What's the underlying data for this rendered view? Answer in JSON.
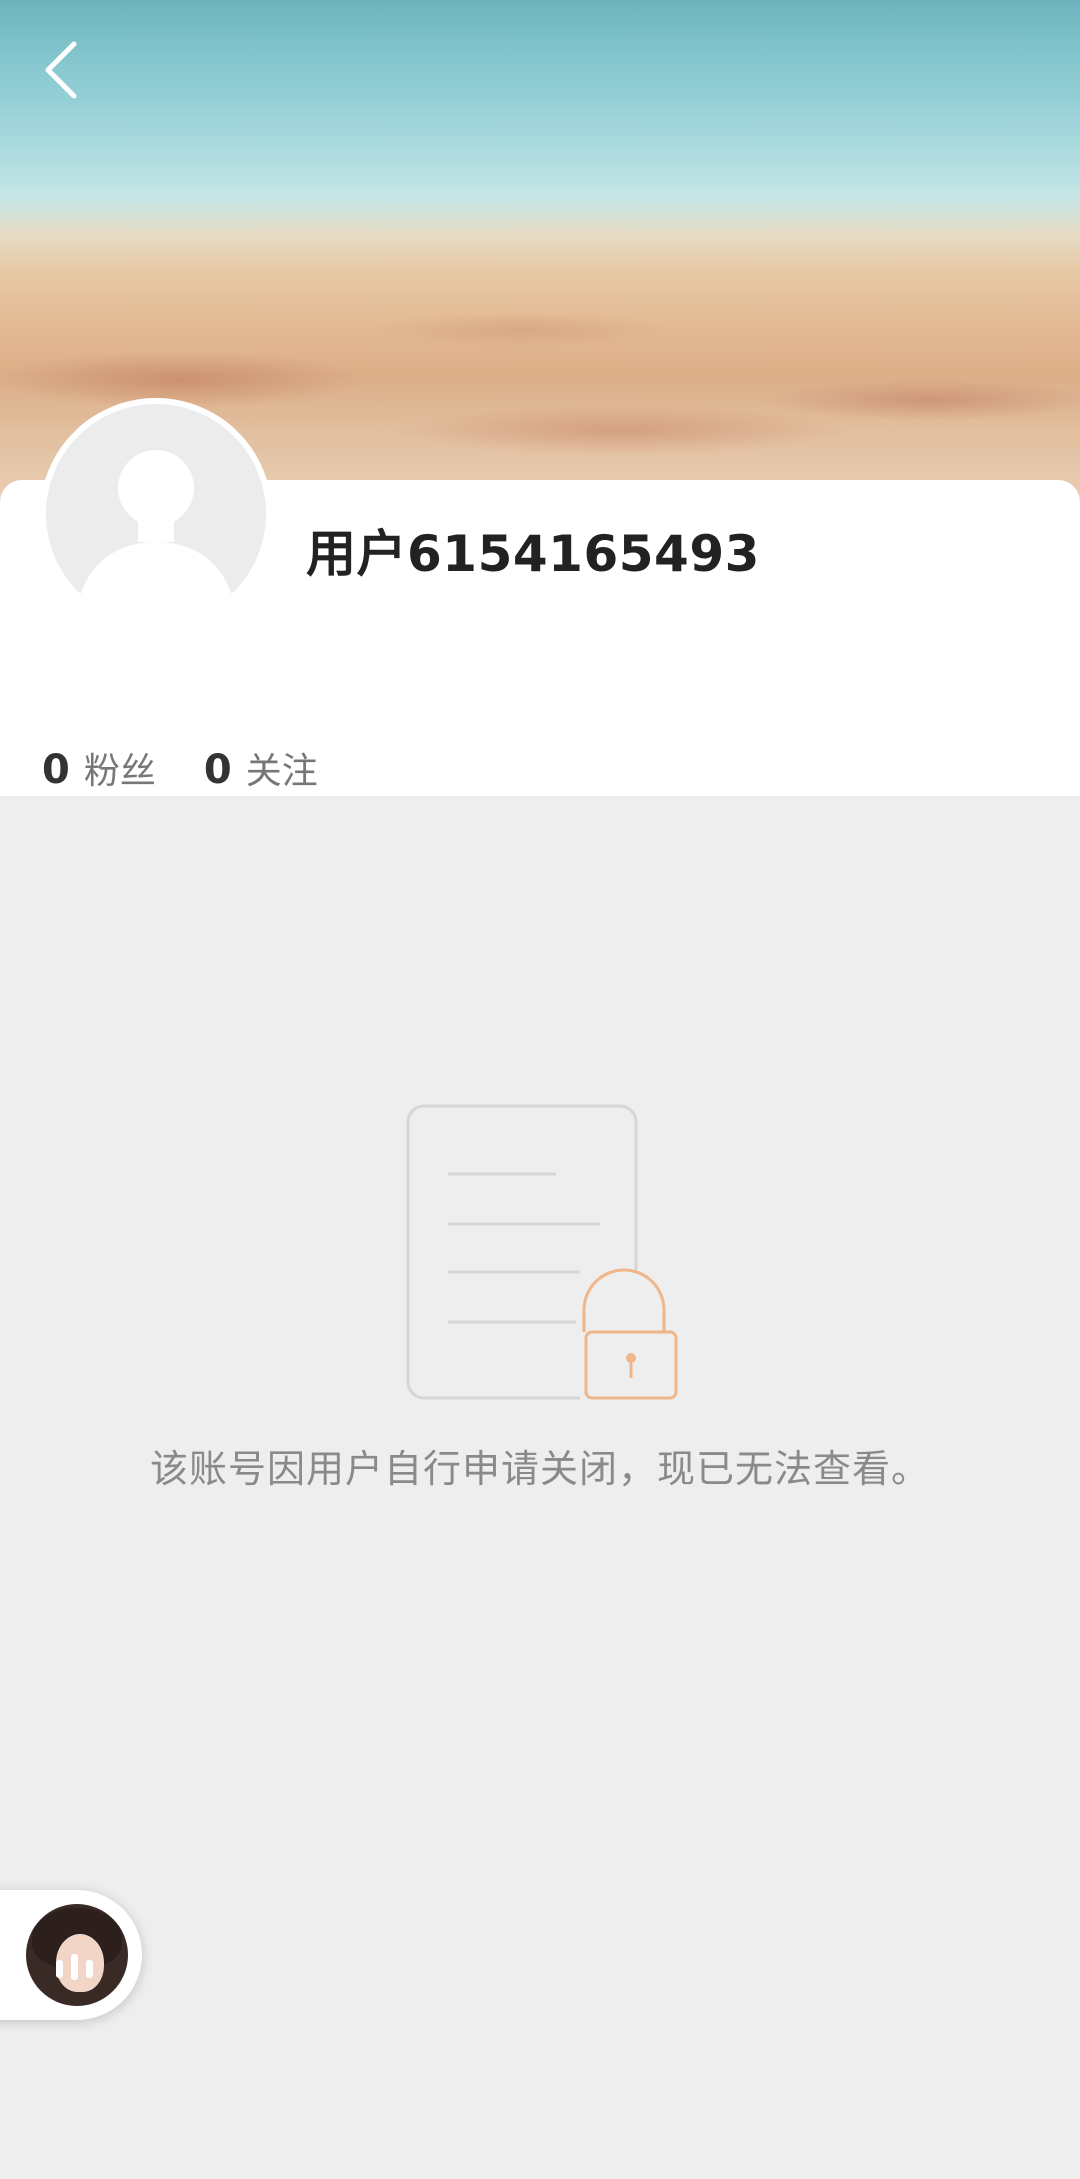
{
  "header": {
    "back_icon": "chevron-left-icon"
  },
  "profile": {
    "username": "用户6154165493",
    "avatar_icon": "default-avatar-icon",
    "stats": [
      {
        "count": "0",
        "label": "粉丝"
      },
      {
        "count": "0",
        "label": "关注"
      }
    ]
  },
  "closed_state": {
    "icon": "locked-document-icon",
    "message": "该账号因用户自行申请关闭，现已无法查看。"
  },
  "floating_player": {
    "icon": "audio-playing-icon"
  },
  "colors": {
    "lock_accent": "#f0b68a",
    "document_stroke": "#d6d6d6",
    "background": "#eeeeee"
  }
}
